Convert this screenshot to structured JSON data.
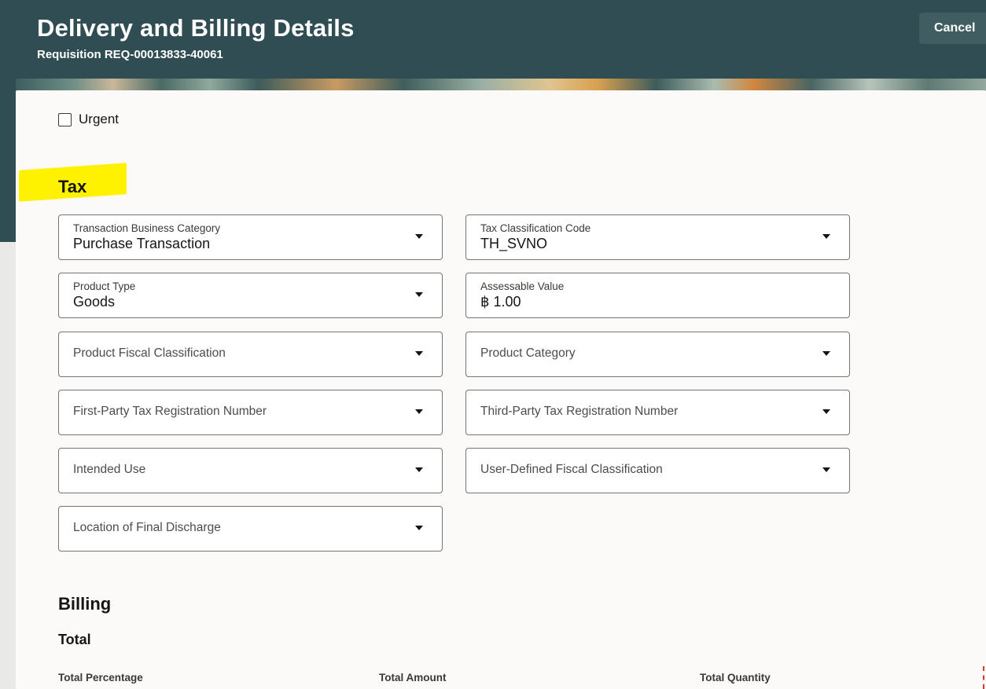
{
  "header": {
    "title": "Delivery and Billing Details",
    "subtitle": "Requisition REQ-00013833-40061",
    "cancel_label": "Cancel"
  },
  "urgent": {
    "label": "Urgent",
    "checked": false
  },
  "tax": {
    "heading": "Tax",
    "fields": {
      "transaction_business_category": {
        "label": "Transaction Business Category",
        "value": "Purchase Transaction"
      },
      "tax_classification_code": {
        "label": "Tax Classification Code",
        "value": "TH_SVNO"
      },
      "product_type": {
        "label": "Product Type",
        "value": "Goods"
      },
      "assessable_value": {
        "label": "Assessable Value",
        "value": "฿ 1.00"
      },
      "product_fiscal_classification": {
        "label": "Product Fiscal Classification",
        "value": ""
      },
      "product_category": {
        "label": "Product Category",
        "value": ""
      },
      "first_party_tax_registration_number": {
        "label": "First-Party Tax Registration Number",
        "value": ""
      },
      "third_party_tax_registration_number": {
        "label": "Third-Party Tax Registration Number",
        "value": ""
      },
      "intended_use": {
        "label": "Intended Use",
        "value": ""
      },
      "user_defined_fiscal_classification": {
        "label": "User-Defined Fiscal Classification",
        "value": ""
      },
      "location_of_final_discharge": {
        "label": "Location of Final Discharge",
        "value": ""
      }
    }
  },
  "billing": {
    "heading": "Billing",
    "total": {
      "heading": "Total",
      "columns": [
        "Total Percentage",
        "Total Amount",
        "Total Quantity"
      ]
    }
  },
  "icons": {
    "dropdown": "chevron-down-icon",
    "checkbox": "checkbox-icon"
  },
  "colors": {
    "header_bg": "#2f4d52",
    "highlight": "#fff200",
    "card_bg": "#fbfaf9"
  }
}
